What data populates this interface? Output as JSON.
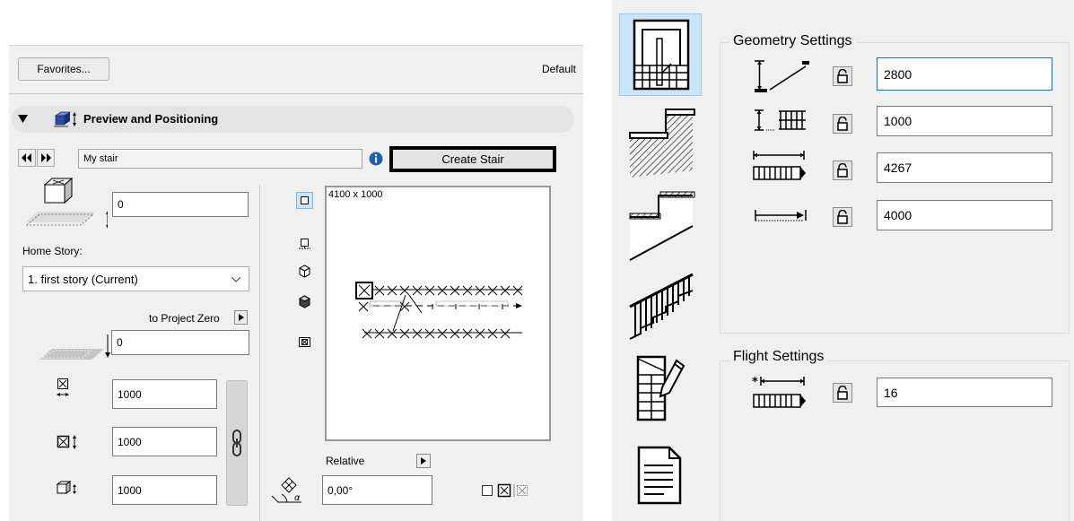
{
  "left": {
    "favorites_label": "Favorites...",
    "default_label": "Default",
    "section_title": "Preview and Positioning",
    "stair_name": "My stair",
    "create_stair_label": "Create Stair",
    "elevation_value": "0",
    "home_story_label": "Home Story:",
    "home_story_value": "1. first story (Current)",
    "to_project_zero_label": "to Project Zero",
    "offset_value": "0",
    "width_value": "1000",
    "height_value": "1000",
    "depth_value": "1000",
    "preview_dimensions": "4100 x 1000",
    "relative_label": "Relative",
    "angle_value": "0,00°"
  },
  "right": {
    "geometry_title": "Geometry Settings",
    "geometry_values": [
      "2800",
      "1000",
      "4267",
      "4000"
    ],
    "flight_title": "Flight Settings",
    "flight_value": "16"
  },
  "colors": {
    "panel_bg": "#f0f0f0",
    "selected_tab": "#cce4f7",
    "focus_border": "#0078d7",
    "info_blue": "#1e5fb4"
  }
}
